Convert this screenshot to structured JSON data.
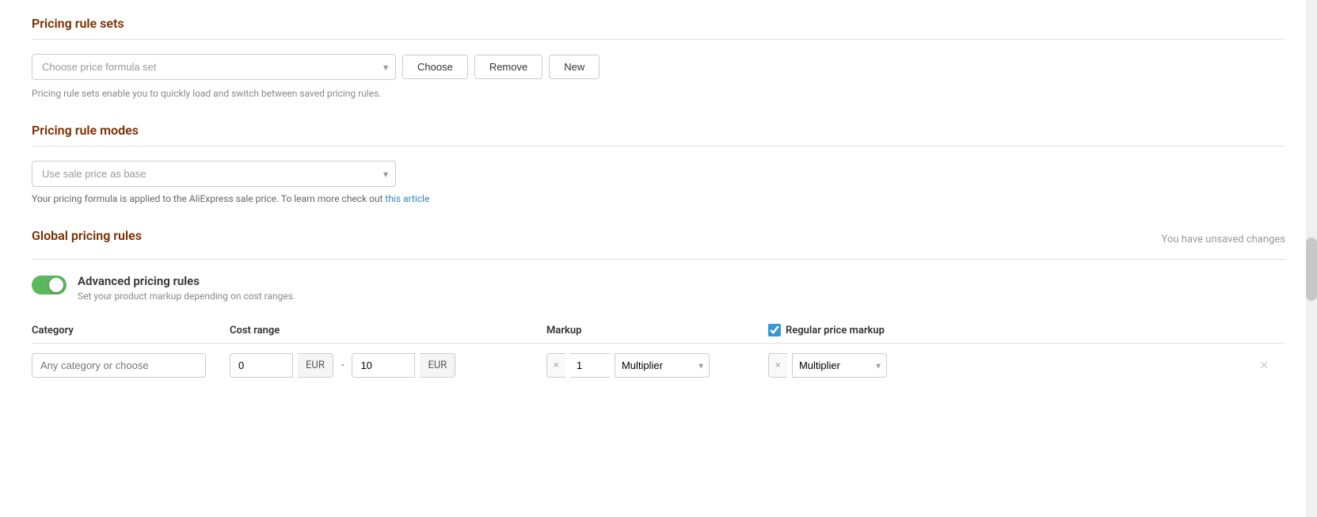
{
  "page": {
    "title": "Pricing rule sets"
  },
  "pricing_rule_sets": {
    "section_title": "Pricing rule sets",
    "dropdown_placeholder": "Choose price formula set",
    "choose_button": "Choose",
    "remove_button": "Remove",
    "new_button": "New",
    "info_text": "Pricing rule sets enable you to quickly load and switch between saved pricing rules."
  },
  "pricing_rule_modes": {
    "section_title": "Pricing rule modes",
    "dropdown_value": "Use sale price as base",
    "description_text": "Your pricing formula is applied to the AliExpress sale price. To learn more check out",
    "link_text": "this article"
  },
  "global_pricing_rules": {
    "section_title": "Global pricing rules",
    "unsaved_text": "You have unsaved changes",
    "advanced": {
      "title": "Advanced pricing rules",
      "subtitle": "Set your product markup depending on cost ranges.",
      "enabled": true
    },
    "table": {
      "headers": {
        "category": "Category",
        "cost_range": "Cost range",
        "markup": "Markup",
        "regular_price_markup": "Regular price markup"
      },
      "rows": [
        {
          "category_placeholder": "Any category or choose",
          "cost_from": "0",
          "cost_from_currency": "EUR",
          "cost_to": "10",
          "cost_to_currency": "EUR",
          "markup_x_label": "×",
          "markup_value": "1",
          "markup_type": "Multiplier",
          "regular_markup_enabled": true,
          "regular_markup_x_label": "×",
          "regular_markup_type": "Multiplier"
        }
      ]
    }
  },
  "icons": {
    "chevron_down": "▾",
    "close_x": "×",
    "delete": "×"
  }
}
